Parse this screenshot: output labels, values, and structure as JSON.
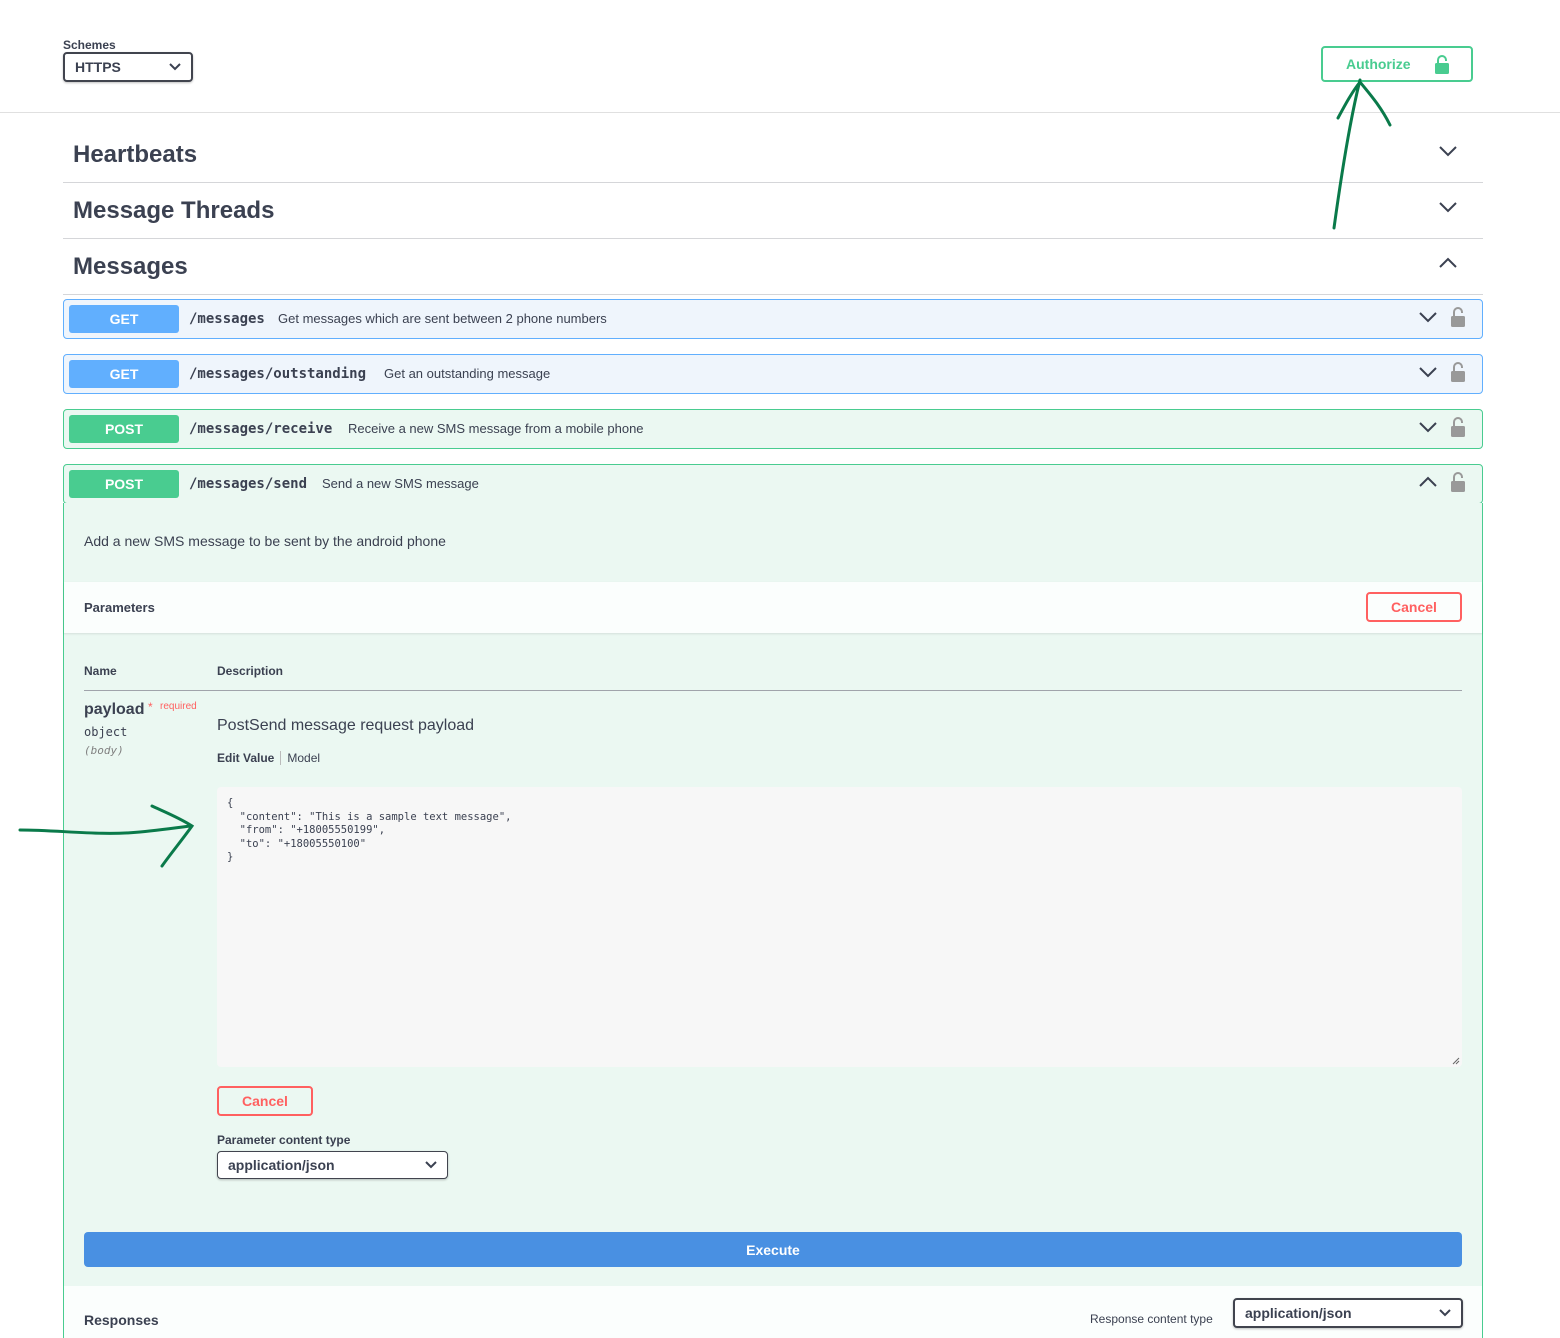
{
  "topbar": {
    "schemes_label": "Schemes",
    "schemes_value": "HTTPS",
    "authorize_label": "Authorize"
  },
  "tags": [
    {
      "title": "Heartbeats",
      "expanded": false
    },
    {
      "title": "Message Threads",
      "expanded": false
    },
    {
      "title": "Messages",
      "expanded": true
    }
  ],
  "operations": [
    {
      "method": "GET",
      "path": "/messages",
      "summary": "Get messages which are sent between 2 phone numbers"
    },
    {
      "method": "GET",
      "path": "/messages/outstanding",
      "summary": "Get an outstanding message"
    },
    {
      "method": "POST",
      "path": "/messages/receive",
      "summary": "Receive a new SMS message from a mobile phone"
    },
    {
      "method": "POST",
      "path": "/messages/send",
      "summary": "Send a new SMS message"
    }
  ],
  "send_op": {
    "description": "Add a new SMS message to be sent by the android phone",
    "parameters_title": "Parameters",
    "cancel_label": "Cancel",
    "col_name": "Name",
    "col_description": "Description",
    "param": {
      "name": "payload",
      "required_star": "*",
      "required_label": "required",
      "type": "object",
      "in": "(body)",
      "description": "PostSend message request payload",
      "tab_edit": "Edit Value",
      "tab_model": "Model",
      "body_value": "{\n  \"content\": \"This is a sample text message\",\n  \"from\": \"+18005550199\",\n  \"to\": \"+18005550100\"\n}"
    },
    "lower_cancel_label": "Cancel",
    "param_content_type_label": "Parameter content type",
    "param_content_type_value": "application/json",
    "execute_label": "Execute",
    "responses_title": "Responses",
    "response_content_type_label": "Response content type",
    "response_content_type_value": "application/json"
  },
  "colors": {
    "get": "#61affe",
    "post": "#49cc90",
    "cancel": "#ff6060",
    "execute": "#4990e2",
    "annotation": "#0a7a4a"
  },
  "icons": [
    "chevron-down-icon",
    "chevron-up-icon",
    "lock-icon",
    "resize-grip-icon"
  ]
}
